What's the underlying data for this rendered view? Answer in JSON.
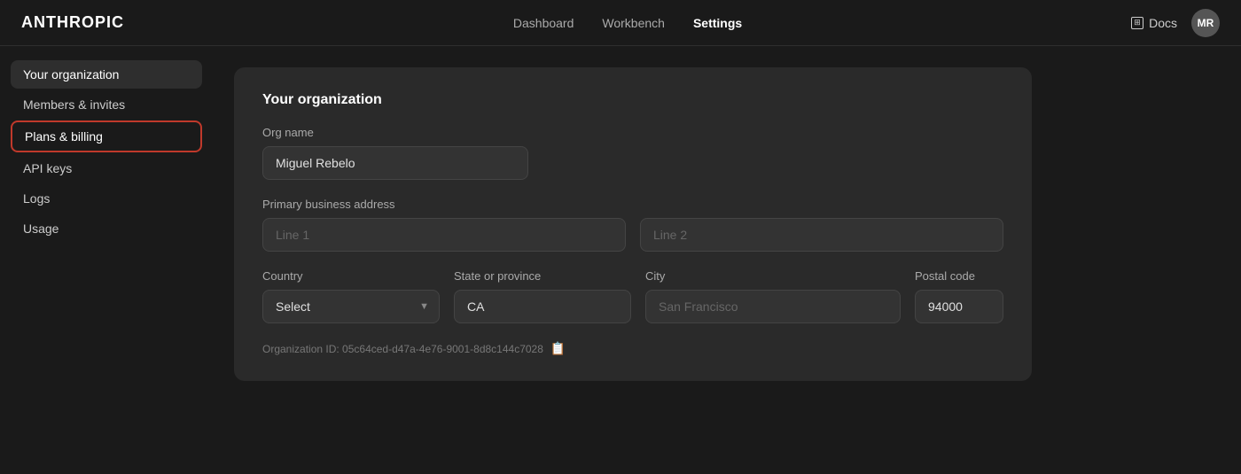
{
  "header": {
    "logo": "ANTHROPIC",
    "nav": [
      {
        "label": "Dashboard",
        "active": false
      },
      {
        "label": "Workbench",
        "active": false
      },
      {
        "label": "Settings",
        "active": true
      }
    ],
    "docs_label": "Docs",
    "avatar_initials": "MR"
  },
  "sidebar": {
    "items": [
      {
        "label": "Your organization",
        "active": true,
        "highlighted": false
      },
      {
        "label": "Members & invites",
        "active": false,
        "highlighted": false
      },
      {
        "label": "Plans & billing",
        "active": false,
        "highlighted": true
      },
      {
        "label": "API keys",
        "active": false,
        "highlighted": false
      },
      {
        "label": "Logs",
        "active": false,
        "highlighted": false
      },
      {
        "label": "Usage",
        "active": false,
        "highlighted": false
      }
    ]
  },
  "main": {
    "card_title": "Your organization",
    "org_name_label": "Org name",
    "org_name_value": "Miguel Rebelo",
    "address_label": "Primary business address",
    "address_line1_placeholder": "Line 1",
    "address_line2_placeholder": "Line 2",
    "country_label": "Country",
    "country_select_default": "Select",
    "state_label": "State or province",
    "state_value": "CA",
    "city_label": "City",
    "city_placeholder": "San Francisco",
    "postal_label": "Postal code",
    "postal_value": "94000",
    "org_id_label": "Organization ID: 05c64ced-d47a-4e76-9001-8d8c144c7028",
    "copy_icon": "📋"
  }
}
